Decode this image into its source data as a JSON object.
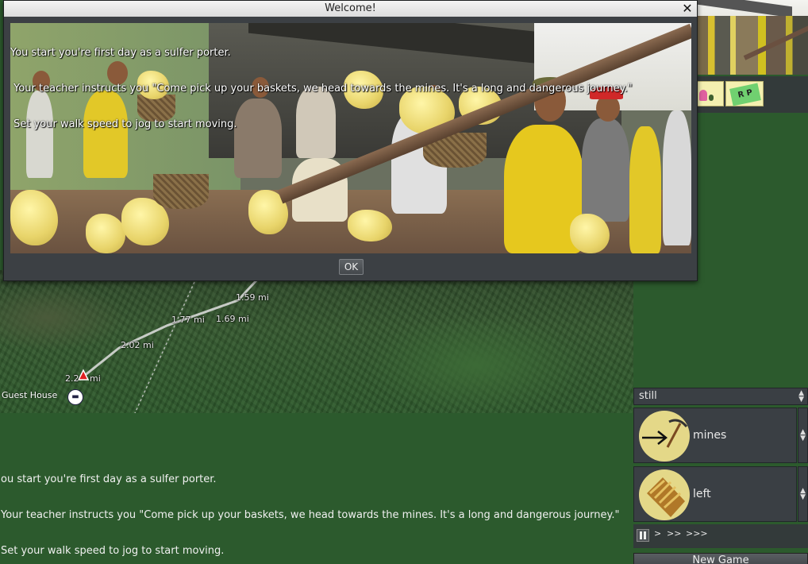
{
  "dialog": {
    "title": "Welcome!",
    "close_symbol": "✕",
    "lines": [
      "You start you're first day as a sulfer porter.",
      " Your teacher instructs you \"Come pick up your baskets, we head towards the mines. It's a long and dangerous journey.\"",
      " Set your walk speed to jog to start moving."
    ],
    "ok_label": "OK"
  },
  "map": {
    "distances": [
      "1.59 mi",
      "1.77 mi",
      "1.69 mi",
      "2.02 mi",
      "2.2",
      "mi"
    ],
    "guest_house_label": "Guest House",
    "guest_house_icon": "bed-icon"
  },
  "messages": {
    "lines": [
      "ou start you're first day as a sulfer porter.",
      "Your teacher instructs you \"Come pick up your baskets, we head towards the mines. It's a long and dangerous journey.\"",
      "Set your walk speed to jog to start moving."
    ]
  },
  "tokens": {
    "sign_text": "R P"
  },
  "controls": {
    "speed_value": "still",
    "destination_label": "mines",
    "destination_icon": "arrow-pickaxe-icon",
    "basket_label": "left",
    "basket_icon": "basket-icon",
    "speed_buttons": [
      ">",
      ">>",
      ">>>"
    ],
    "new_game_label": "New Game"
  }
}
